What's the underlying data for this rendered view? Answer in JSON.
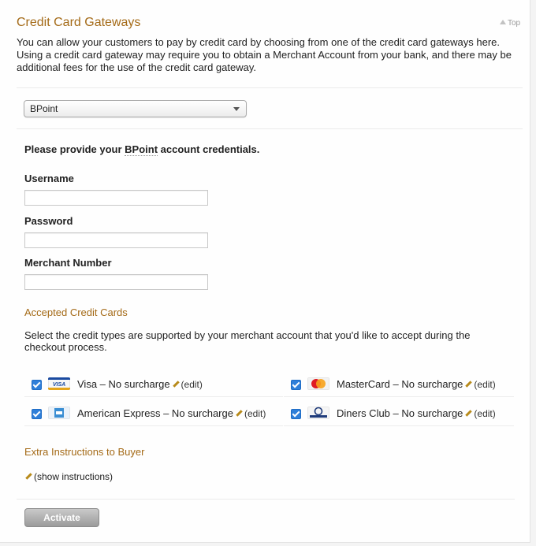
{
  "header": {
    "title": "Credit Card Gateways",
    "top_link": "Top",
    "intro": "You can allow your customers to pay by credit card by choosing from one of the credit card gateways here. Using a credit card gateway may require you to obtain a Merchant Account from your bank, and there may be additional fees for the use of the credit card gateway."
  },
  "gateway_select": {
    "selected": "BPoint"
  },
  "credentials": {
    "prompt_before": "Please provide your ",
    "gateway_name": "BPoint",
    "prompt_after": " account credentials.",
    "username_label": "Username",
    "username_value": "",
    "password_label": "Password",
    "password_value": "",
    "merchant_label": "Merchant Number",
    "merchant_value": ""
  },
  "accepted_cards": {
    "heading": "Accepted Credit Cards",
    "description": "Select the credit types are supported by your merchant account that you'd like to accept during the checkout process.",
    "edit_label": "(edit)",
    "cards": [
      {
        "name": "Visa – No surcharge",
        "checked": true,
        "logo": "visa-logo"
      },
      {
        "name": "MasterCard – No surcharge",
        "checked": true,
        "logo": "mastercard-logo"
      },
      {
        "name": "American Express – No surcharge",
        "checked": true,
        "logo": "amex-logo"
      },
      {
        "name": "Diners Club – No surcharge",
        "checked": true,
        "logo": "diners-logo"
      }
    ]
  },
  "extra": {
    "heading": "Extra Instructions to Buyer",
    "show_label": "(show instructions)"
  },
  "actions": {
    "activate": "Activate"
  },
  "colors": {
    "accent": "#a46a17",
    "checkbox": "#2f7fd9"
  }
}
